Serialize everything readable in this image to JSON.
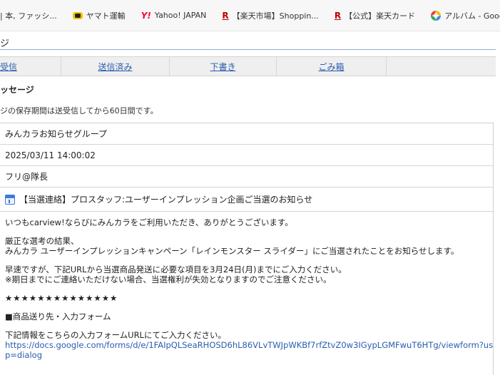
{
  "bookmarks": [
    {
      "label": "| 本, ファッシ...",
      "icon": "none"
    },
    {
      "label": "ヤマト運輸",
      "icon": "yamato-icon"
    },
    {
      "label": "Yahoo! JAPAN",
      "icon": "yahoo-icon",
      "glyph": "Y!"
    },
    {
      "label": "【楽天市場】Shoppin...",
      "icon": "rakuten-icon",
      "glyph": "R"
    },
    {
      "label": "【公式】楽天カード",
      "icon": "rakuten-card-icon",
      "glyph": "R"
    },
    {
      "label": "アルバム - Google フ...",
      "icon": "google-photos-icon"
    }
  ],
  "page": {
    "title": "ジ"
  },
  "tabs": [
    {
      "label": "受信"
    },
    {
      "label": "送信済み"
    },
    {
      "label": "下書き"
    },
    {
      "label": "ごみ箱"
    },
    {
      "label": ""
    }
  ],
  "section": {
    "title": "ッセージ",
    "note": "ジの保存期間は送受信してから60日間です。"
  },
  "message": {
    "sender": "みんカラお知らせグループ",
    "datetime": "2025/03/11 14:00:02",
    "recipient": "フリ@隊長",
    "subject": "【当選連絡】プロスタッフ:ユーザーインプレッション企画ご当選のお知らせ",
    "body": {
      "greeting": "いつもcarview!ならびにみんカラをご利用いただき、ありがとうございます。",
      "result_line1": "厳正な選考の結果、",
      "result_line2": "みんカラ ユーザーインプレッションキャンペーン「レインモンスター スライダー」にご当選されたことをお知らせします。",
      "request_line1": "早速ですが、下記URLから当選商品発送に必要な項目を3月24日(月)までにご入力ください。",
      "request_line2": "※期日までにご連絡いただけない場合、当選権利が失効となりますのでご注意ください。",
      "stars": "★★★★★★★★★★★★★★",
      "form_heading": "■商品送り先・入力フォーム",
      "form_instruction": "下記情報をこちらの入力フォームURLにてご入力ください。",
      "form_url": "https://docs.google.com/forms/d/e/1FAIpQLSeaRHOSD6hL86VLvTWJpWKBf7rfZtvZ0w3IGypLGMFwuT6HTg/viewform?usp=dialog"
    }
  }
}
